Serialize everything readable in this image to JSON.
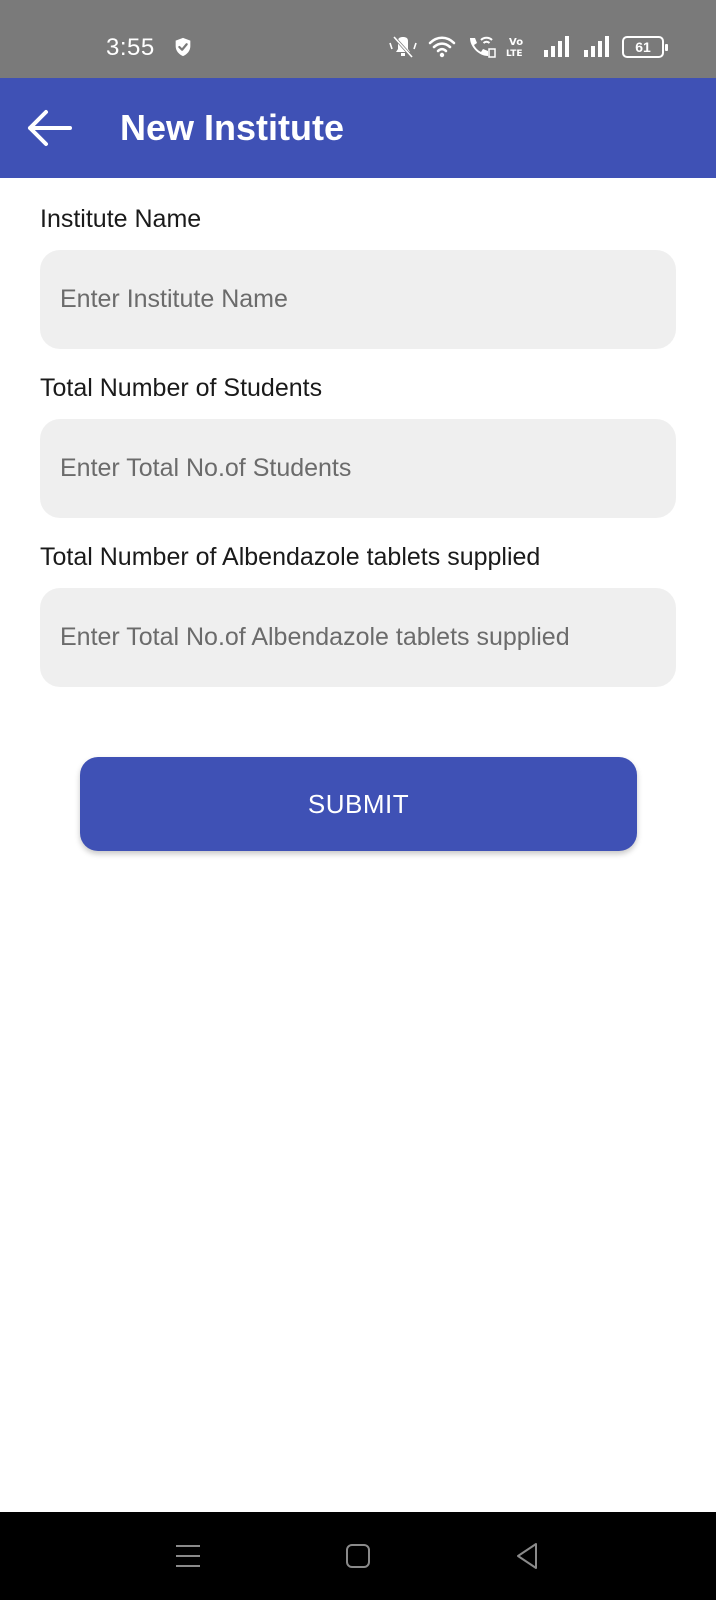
{
  "status_bar": {
    "time": "3:55",
    "left_icon": "shield-check-icon",
    "right_icons": [
      "mute-icon",
      "wifi-icon",
      "wifi-call-icon",
      "volte-icon",
      "signal-icon",
      "signal-icon"
    ],
    "volte_label": "Vo LTE",
    "battery": "61",
    "background": "#7a7a7a"
  },
  "app_bar": {
    "back_icon": "arrow-left-icon",
    "title": "New Institute",
    "background": "#3f51b5"
  },
  "form": {
    "fields": [
      {
        "label": "Institute Name",
        "value": "",
        "placeholder": "Enter Institute Name"
      },
      {
        "label": "Total Number of Students",
        "value": "",
        "placeholder": "Enter Total No.of Students"
      },
      {
        "label": "Total Number of Albendazole tablets supplied",
        "value": "",
        "placeholder": "Enter Total No.of Albendazole tablets supplied"
      }
    ],
    "submit_label": "SUBMIT",
    "input_background": "#efefef",
    "accent": "#3f51b5"
  },
  "nav_bar": {
    "items": [
      "menu-icon",
      "home-square-icon",
      "back-triangle-icon"
    ],
    "background": "#000000"
  }
}
